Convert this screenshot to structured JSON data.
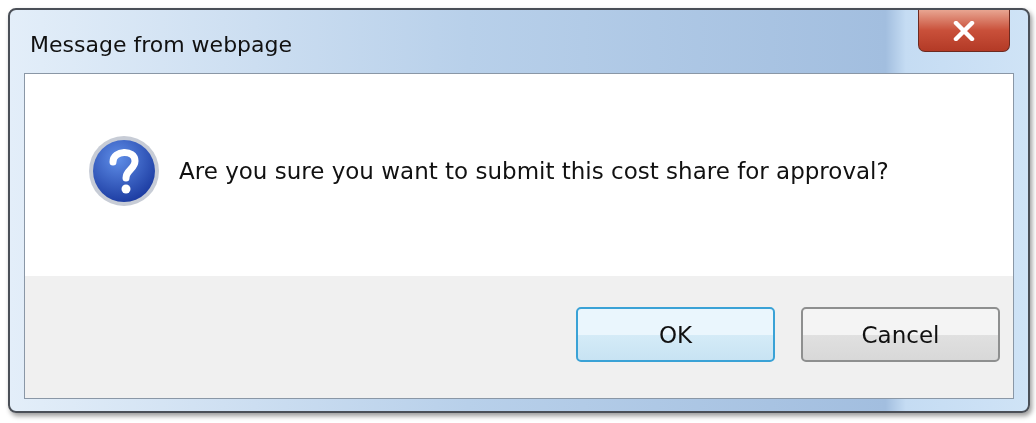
{
  "window": {
    "title": "Message from webpage"
  },
  "message": {
    "kind": "question",
    "text": "Are you sure you want to submit this cost share for approval?"
  },
  "buttons": [
    {
      "label": "OK",
      "default": true
    },
    {
      "label": "Cancel",
      "default": false
    }
  ]
}
